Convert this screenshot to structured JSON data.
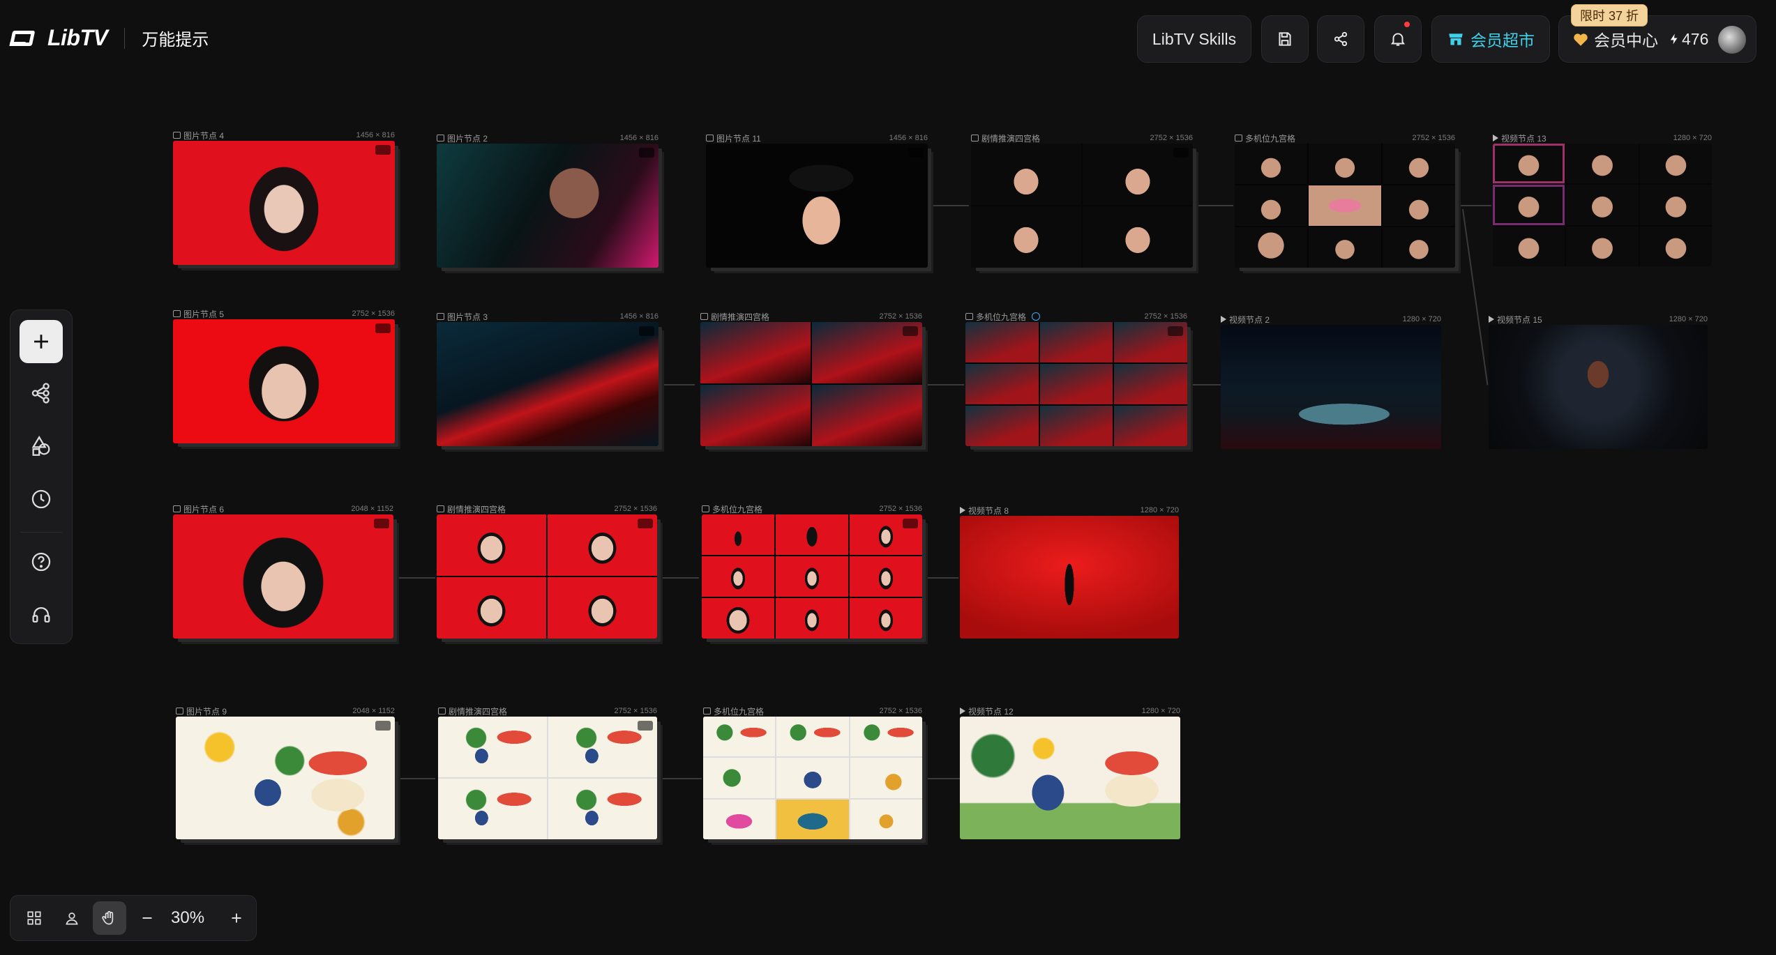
{
  "header": {
    "logo_text": "LibTV",
    "app_title": "万能提示",
    "skills_label": "LibTV Skills",
    "store_label": "会员超市",
    "discount_badge": "限时 37 折",
    "member_label": "会员中心",
    "credits": "476"
  },
  "zoom": {
    "value": "30%"
  },
  "nodes": [
    {
      "title": "图片节点 4",
      "dims": "1456 × 816"
    },
    {
      "title": "图片节点 2",
      "dims": "1456 × 816"
    },
    {
      "title": "图片节点 11",
      "dims": "1456 × 816"
    },
    {
      "title": "剧情推演四宫格",
      "dims": "2752 × 1536"
    },
    {
      "title": "多机位九宫格",
      "dims": "2752 × 1536"
    },
    {
      "title": "视频节点 13",
      "dims": "1280 × 720"
    },
    {
      "title": "图片节点 5",
      "dims": "2752 × 1536"
    },
    {
      "title": "图片节点 3",
      "dims": "1456 × 816"
    },
    {
      "title": "剧情推演四宫格",
      "dims": "2752 × 1536"
    },
    {
      "title": "多机位九宫格",
      "dims": "2752 × 1536"
    },
    {
      "title": "视频节点 2",
      "dims": "1280 × 720"
    },
    {
      "title": "视频节点 15",
      "dims": "1280 × 720"
    },
    {
      "title": "图片节点 6",
      "dims": "2048 × 1152"
    },
    {
      "title": "剧情推演四宫格",
      "dims": "2752 × 1536"
    },
    {
      "title": "多机位九宫格",
      "dims": "2752 × 1536"
    },
    {
      "title": "视频节点 8",
      "dims": "1280 × 720"
    },
    {
      "title": "图片节点 9",
      "dims": "2048 × 1152"
    },
    {
      "title": "剧情推演四宫格",
      "dims": "2752 × 1536"
    },
    {
      "title": "多机位九宫格",
      "dims": "2752 × 1536"
    },
    {
      "title": "视频节点 12",
      "dims": "1280 × 720"
    }
  ],
  "colors": {
    "red": "#e0101c",
    "dark": "#0b0b0c",
    "teal": "#0f2b33",
    "cream": "#f4efe2"
  },
  "icons": [
    "plus-icon",
    "workflow-icon",
    "shapes-icon",
    "history-icon",
    "help-icon",
    "headset-icon",
    "grid-icon",
    "user-pin-icon",
    "hand-icon",
    "minus-icon",
    "save-icon",
    "share-icon",
    "bell-icon",
    "store-icon",
    "heart-icon",
    "bolt-icon"
  ]
}
